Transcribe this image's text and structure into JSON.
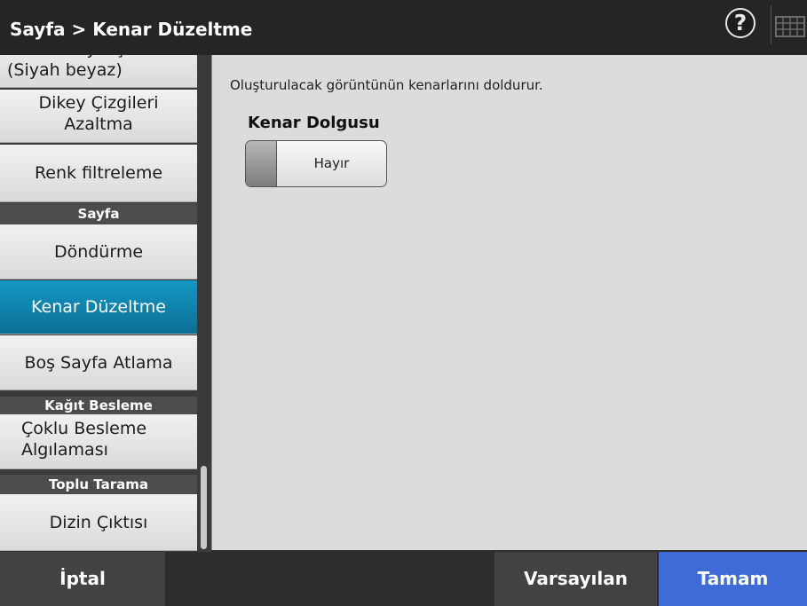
{
  "header": {
    "title": "Sayfa > Kenar Düzeltme",
    "help_icon_glyph": "?"
  },
  "sidebar": {
    "items": [
      {
        "label": "Görüntü İyileştirme (Siyah beyaz)"
      },
      {
        "label": "Dikey Çizgileri Azaltma"
      },
      {
        "label": "Renk filtreleme"
      },
      {
        "section": "Sayfa"
      },
      {
        "label": "Döndürme"
      },
      {
        "label": "Kenar Düzeltme",
        "active": true
      },
      {
        "label": "Boş Sayfa Atlama"
      },
      {
        "section": "Kağıt Besleme"
      },
      {
        "label": "Çoklu Besleme Algılaması"
      },
      {
        "section": "Toplu Tarama"
      },
      {
        "label": "Dizin Çıktısı"
      }
    ]
  },
  "main": {
    "description": "Oluşturulacak görüntünün kenarlarını doldurur.",
    "field_label": "Kenar Dolgusu",
    "toggle_value": "Hayır"
  },
  "footer": {
    "cancel": "İptal",
    "default": "Varsayılan",
    "ok": "Tamam"
  },
  "colors": {
    "active_item": "#0b7ea8",
    "ok_button": "#3e6bd6",
    "title_bar": "#252525"
  }
}
